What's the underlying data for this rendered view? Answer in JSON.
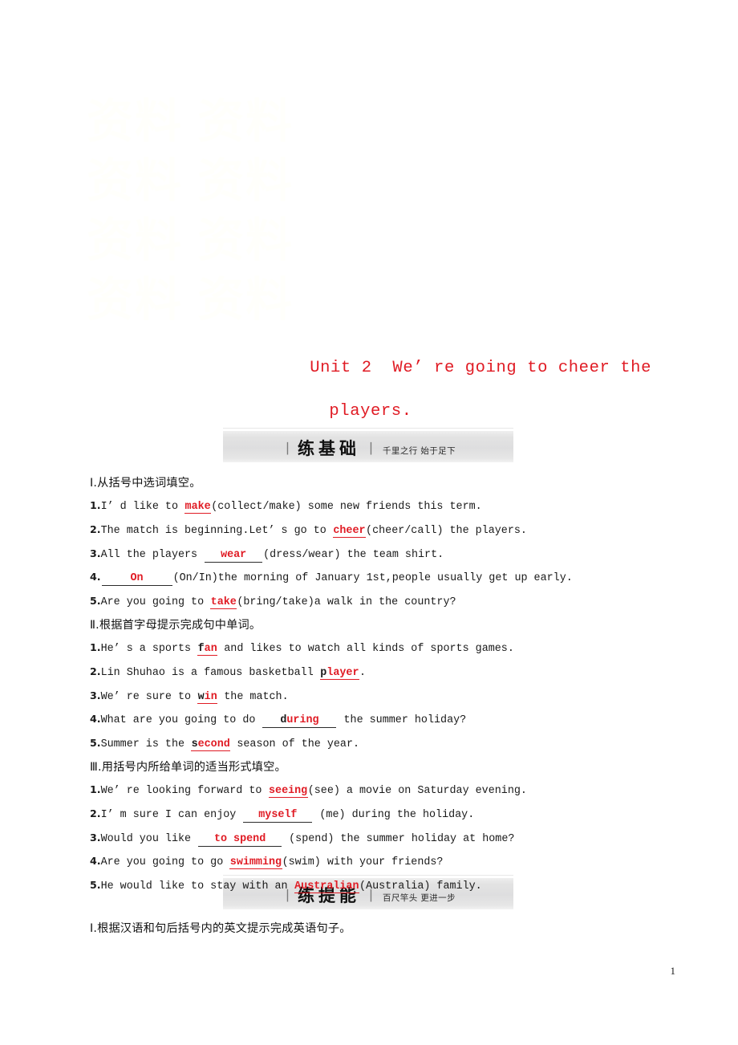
{
  "page": {
    "watermark": "资料",
    "page_number": "1"
  },
  "title": {
    "line1": "Unit 2  We’ re going to cheer the",
    "line2": "players."
  },
  "banners": [
    {
      "id": "practice-basics",
      "bar": "丨",
      "title": "练基础",
      "divider": "丨",
      "subtitle": "千里之行 始于足下"
    },
    {
      "id": "practice-advanced",
      "bar": "丨",
      "title": "练提能",
      "divider": "丨",
      "subtitle": "百尺竿头 更进一步"
    }
  ],
  "sections": [
    {
      "heading": "Ⅰ.从括号中选词填空。",
      "items": [
        {
          "num": "1.",
          "parts": [
            {
              "t": "text",
              "v": "I’ d like to "
            },
            {
              "t": "ans",
              "v": "make"
            },
            {
              "t": "text",
              "v": "(collect/make) some new friends this term."
            }
          ]
        },
        {
          "num": "2.",
          "parts": [
            {
              "t": "text",
              "v": "The match is beginning.Let’ s go to "
            },
            {
              "t": "ans",
              "v": "cheer"
            },
            {
              "t": "text",
              "v": "(cheer/call) the players."
            }
          ]
        },
        {
          "num": "3.",
          "parts": [
            {
              "t": "text",
              "v": "All the players "
            },
            {
              "t": "blank",
              "v": "wear",
              "width": "72"
            },
            {
              "t": "text",
              "v": "(dress/wear) the team shirt."
            }
          ]
        },
        {
          "num": "4.",
          "parts": [
            {
              "t": "blank",
              "v": "On",
              "width": "88"
            },
            {
              "t": "text",
              "v": "(On/In)the morning of January 1st,people usually get up early."
            }
          ]
        },
        {
          "num": "5.",
          "parts": [
            {
              "t": "text",
              "v": "Are you going to "
            },
            {
              "t": "ans",
              "v": "take"
            },
            {
              "t": "text",
              "v": "(bring/take)a walk in the country?"
            }
          ]
        }
      ]
    },
    {
      "heading": "Ⅱ.根据首字母提示完成句中单词。",
      "items": [
        {
          "num": "1.",
          "parts": [
            {
              "t": "text",
              "v": "He’ s a sports "
            },
            {
              "t": "ans",
              "given": "f",
              "v": "an"
            },
            {
              "t": "text",
              "v": " and likes to watch all kinds of sports games."
            }
          ]
        },
        {
          "num": "2.",
          "parts": [
            {
              "t": "text",
              "v": "Lin Shuhao is a famous basketball "
            },
            {
              "t": "ans",
              "given": "p",
              "v": "layer"
            },
            {
              "t": "text",
              "v": "."
            }
          ]
        },
        {
          "num": "3.",
          "parts": [
            {
              "t": "text",
              "v": "We’ re sure to "
            },
            {
              "t": "ans",
              "given": "w",
              "v": "in"
            },
            {
              "t": "text",
              "v": " the match."
            }
          ]
        },
        {
          "num": "4.",
          "parts": [
            {
              "t": "text",
              "v": "What are you going to do "
            },
            {
              "t": "blank",
              "given": "d",
              "v": "uring",
              "width": "92"
            },
            {
              "t": "text",
              "v": " the summer holiday?"
            }
          ]
        },
        {
          "num": "5.",
          "parts": [
            {
              "t": "text",
              "v": "Summer is the "
            },
            {
              "t": "ans",
              "given": "s",
              "v": "econd"
            },
            {
              "t": "text",
              "v": " season of the year."
            }
          ]
        }
      ]
    },
    {
      "heading": "Ⅲ.用括号内所给单词的适当形式填空。",
      "items": [
        {
          "num": "1.",
          "parts": [
            {
              "t": "text",
              "v": "We’ re looking forward to "
            },
            {
              "t": "ans",
              "v": "seeing"
            },
            {
              "t": "text",
              "v": "(see) a movie on Saturday evening."
            }
          ]
        },
        {
          "num": "2.",
          "parts": [
            {
              "t": "text",
              "v": "I’ m sure I can enjoy "
            },
            {
              "t": "blank",
              "v": "myself",
              "width": "86"
            },
            {
              "t": "text",
              "v": " (me) during the holiday."
            }
          ]
        },
        {
          "num": "3.",
          "parts": [
            {
              "t": "text",
              "v": "Would you like "
            },
            {
              "t": "blank",
              "v": "to spend",
              "width": "104"
            },
            {
              "t": "text",
              "v": " (spend) the summer holiday at home?"
            }
          ]
        },
        {
          "num": "4.",
          "parts": [
            {
              "t": "text",
              "v": "Are you going to go "
            },
            {
              "t": "ans",
              "v": "swimming"
            },
            {
              "t": "text",
              "v": "(swim) with your friends?"
            }
          ]
        },
        {
          "num": "5.",
          "parts": [
            {
              "t": "text",
              "v": "He would like to stay with an "
            },
            {
              "t": "ans",
              "v": "Australian"
            },
            {
              "t": "text",
              "v": "(Australia) family."
            }
          ]
        }
      ]
    }
  ],
  "tail_section": {
    "heading": "Ⅰ.根据汉语和句后括号内的英文提示完成英语句子。"
  }
}
